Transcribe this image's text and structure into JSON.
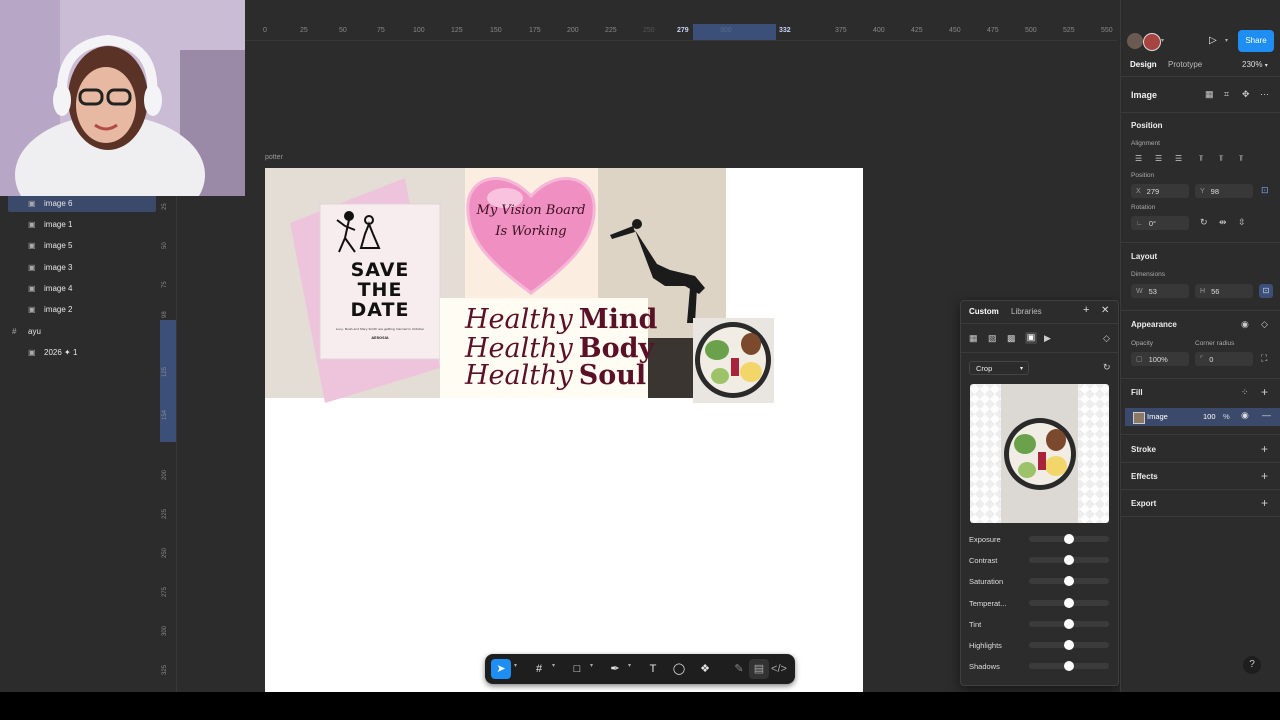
{
  "layers": [
    {
      "name": "image 6",
      "selected": true
    },
    {
      "name": "image 1"
    },
    {
      "name": "image 5"
    },
    {
      "name": "image 3"
    },
    {
      "name": "image 4"
    },
    {
      "name": "image 2"
    }
  ],
  "group": {
    "name": "ayu",
    "child": "2026 ✦ 1"
  },
  "ruler_h": [
    "0",
    "25",
    "50",
    "75",
    "100",
    "125",
    "150",
    "175",
    "200",
    "225",
    "250",
    "279",
    "300",
    "332",
    "375",
    "400",
    "425",
    "450",
    "475",
    "500",
    "525",
    "550"
  ],
  "ruler_v": [
    "25",
    "50",
    "75",
    "98",
    "125",
    "154",
    "200",
    "225",
    "250",
    "275",
    "300",
    "325"
  ],
  "frame_label": "potter",
  "canvas": {
    "save_the_date": [
      "SAVE",
      "THE",
      "DATE"
    ],
    "save_the_date_small": "Lucy, Noah and Mary Smith are getting married in October",
    "save_the_date_venue": "AEROSIA",
    "vision": [
      "My Vision Board",
      "Is Working"
    ],
    "healthy": [
      {
        "word": "Healthy",
        "bold": "Mind"
      },
      {
        "word": "Healthy",
        "bold": "Body"
      },
      {
        "word": "Healthy",
        "bold": "Soul"
      }
    ]
  },
  "header": {
    "tab_design": "Design",
    "tab_prototype": "Prototype",
    "zoom": "230%",
    "share": "Share"
  },
  "inspector": {
    "title": "Image",
    "position_section": "Position",
    "alignment": "Alignment",
    "position_label": "Position",
    "x_label": "X",
    "x": "279",
    "y_label": "Y",
    "y": "98",
    "rotation_label": "Rotation",
    "rotation": "0°",
    "layout_section": "Layout",
    "dimensions": "Dimensions",
    "w_label": "W",
    "w": "53",
    "h_label": "H",
    "h": "56",
    "appearance": "Appearance",
    "opacity_label": "Opacity",
    "opacity": "100%",
    "corner_label": "Corner radius",
    "corner": "0",
    "fill": "Fill",
    "fill_name": "Image",
    "fill_pct": "100",
    "fill_unit": "%",
    "stroke": "Stroke",
    "effects": "Effects",
    "export": "Export"
  },
  "image_panel": {
    "tab_custom": "Custom",
    "tab_libraries": "Libraries",
    "mode": "Crop",
    "adjustments": [
      {
        "label": "Exposure",
        "value": 0.5
      },
      {
        "label": "Contrast",
        "value": 0.5
      },
      {
        "label": "Saturation",
        "value": 0.5
      },
      {
        "label": "Temperat...",
        "value": 0.5
      },
      {
        "label": "Tint",
        "value": 0.5
      },
      {
        "label": "Highlights",
        "value": 0.5
      },
      {
        "label": "Shadows",
        "value": 0.5
      }
    ]
  },
  "colors": {
    "accent": "#1e8ef3",
    "heart": "#f08fc2",
    "maroon": "#5a1026"
  }
}
